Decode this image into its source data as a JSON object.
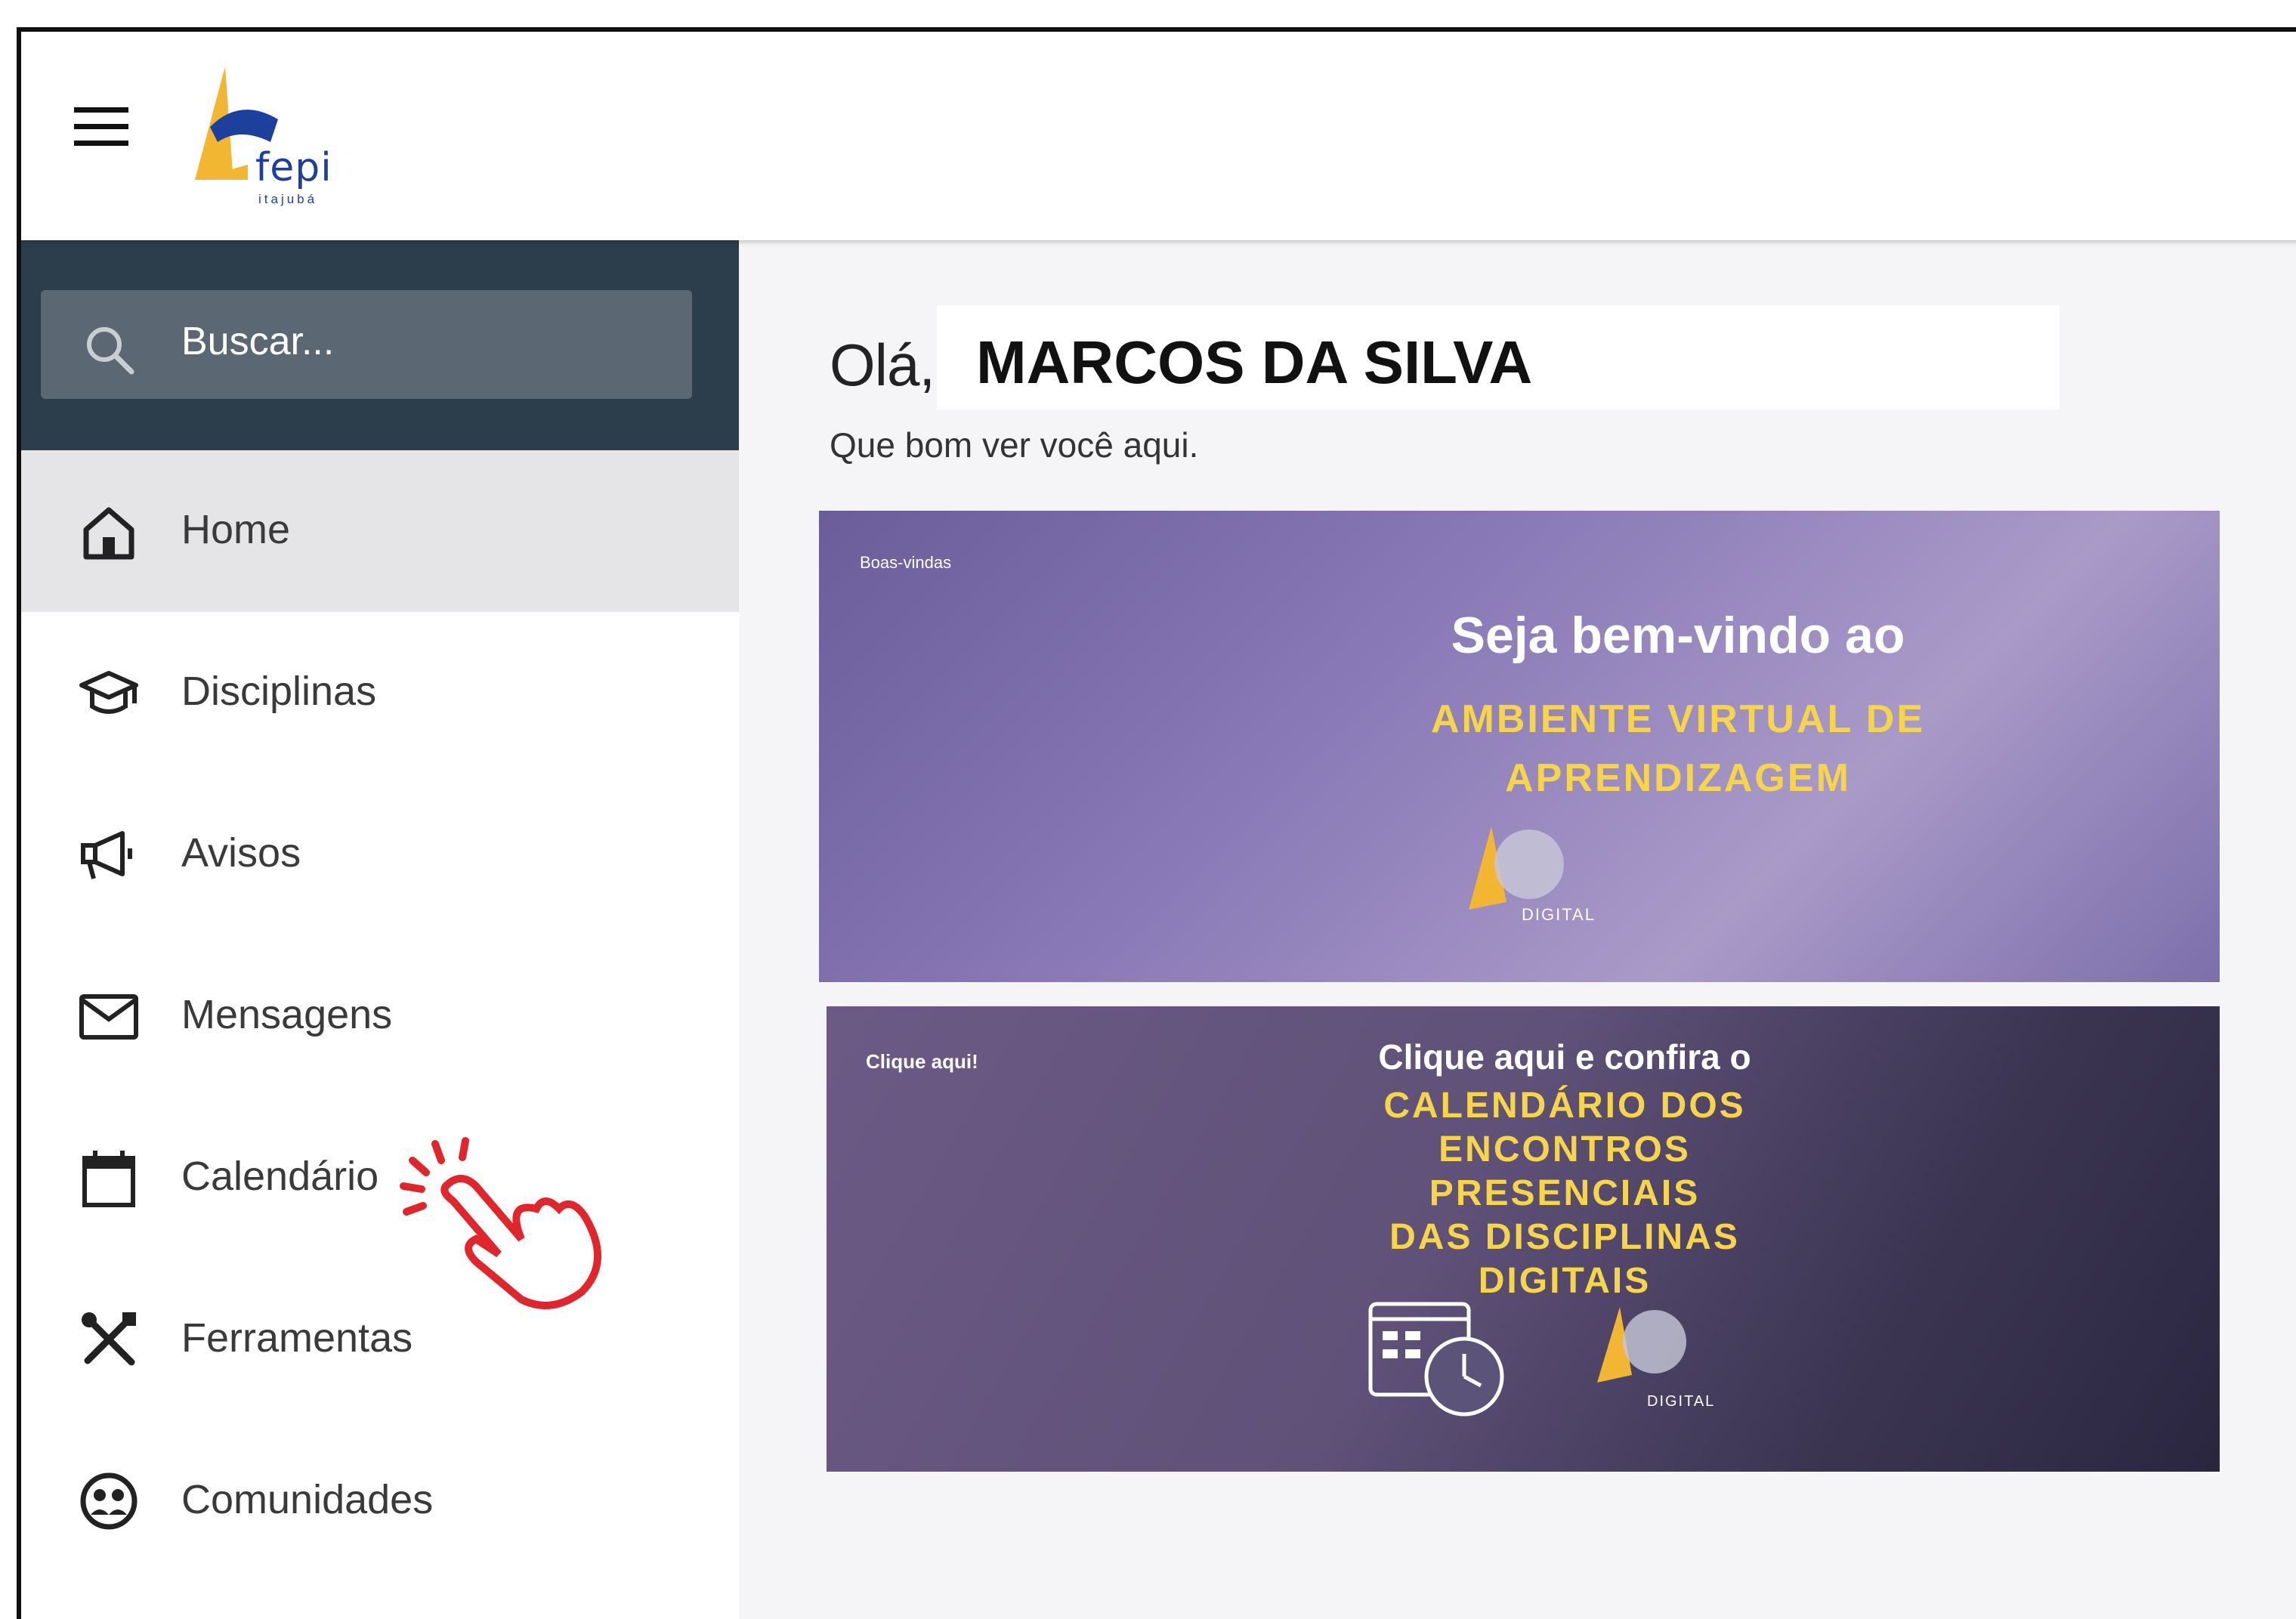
{
  "header": {
    "logo_text": "fepi",
    "logo_sub": "itajubá"
  },
  "search": {
    "placeholder": "Buscar..."
  },
  "sidebar": {
    "items": [
      {
        "label": "Home",
        "icon": "home-icon",
        "active": true
      },
      {
        "label": "Disciplinas",
        "icon": "graduation-cap-icon"
      },
      {
        "label": "Avisos",
        "icon": "megaphone-icon"
      },
      {
        "label": "Mensagens",
        "icon": "mail-icon"
      },
      {
        "label": "Calendário",
        "icon": "calendar-icon"
      },
      {
        "label": "Ferramentas",
        "icon": "tools-icon"
      },
      {
        "label": "Comunidades",
        "icon": "community-icon"
      }
    ]
  },
  "main": {
    "greeting": "Olá,",
    "user_name": "MARCOS DA SILVA",
    "subtitle": "Que bom ver você aqui."
  },
  "banners": [
    {
      "tag": "Boas-vindas",
      "title": "Seja bem-vindo ao",
      "highlight_line1": "AMBIENTE VIRTUAL DE",
      "highlight_line2": "APRENDIZAGEM",
      "brand": "DIGITAL"
    },
    {
      "tag": "Clique aqui!",
      "title": "Clique aqui e confira o",
      "highlight_line1": "CALENDÁRIO DOS",
      "highlight_line2": "ENCONTROS",
      "highlight_line3": "PRESENCIAIS",
      "highlight_line4": "DAS DISCIPLINAS",
      "highlight_line5": "DIGITAIS",
      "brand": "DIGITAL"
    }
  ],
  "colors": {
    "sidebar_header": "#2c3e4c",
    "search_box": "#5b6873",
    "active_item": "#e5e5e8",
    "highlight_yellow": "#f7d54a",
    "pointer_red": "#e0262b"
  }
}
